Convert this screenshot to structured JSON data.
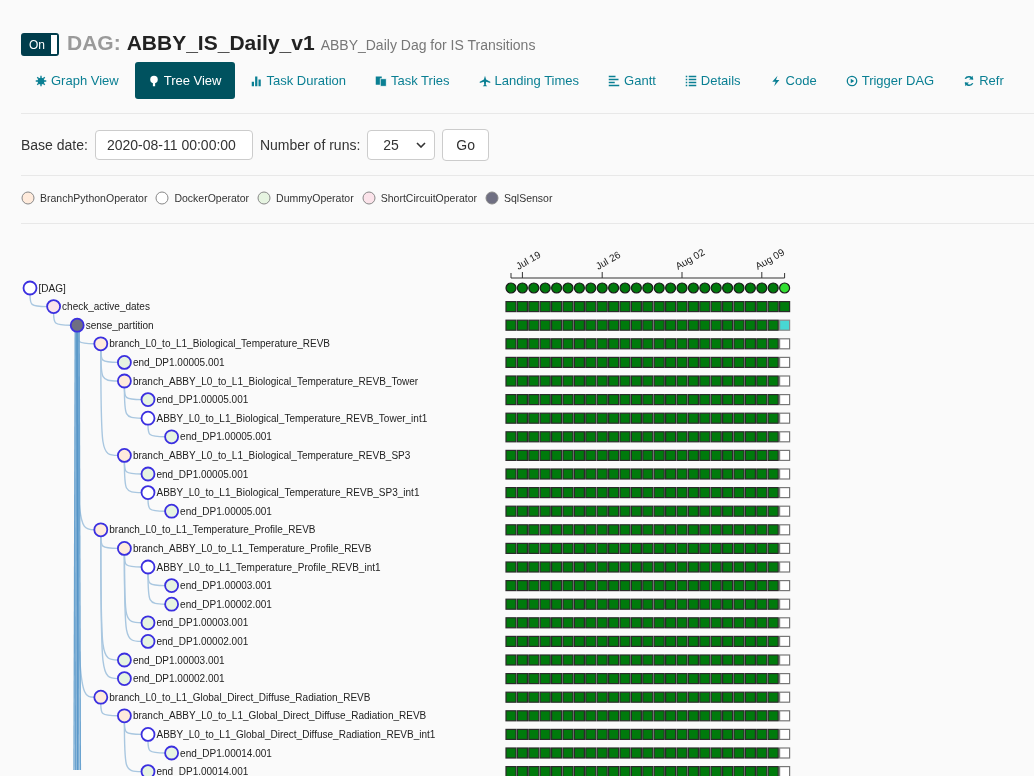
{
  "header": {
    "toggle": {
      "label": "On",
      "on": true
    },
    "prefix": "DAG:",
    "dag_id": "ABBY_IS_Daily_v1",
    "description": "ABBY_Daily Dag for IS Transitions"
  },
  "tabs": [
    {
      "label": "Graph View",
      "selected": false
    },
    {
      "label": "Tree View",
      "selected": true
    },
    {
      "label": "Task Duration",
      "selected": false
    },
    {
      "label": "Task Tries",
      "selected": false
    },
    {
      "label": "Landing Times",
      "selected": false
    },
    {
      "label": "Gantt",
      "selected": false
    },
    {
      "label": "Details",
      "selected": false
    },
    {
      "label": "Code",
      "selected": false
    },
    {
      "label": "Trigger DAG",
      "selected": false
    },
    {
      "label": "Refr",
      "selected": false
    }
  ],
  "form": {
    "base_date_label": "Base date:",
    "base_date": "2020-08-11 00:00:00",
    "runs_label": "Number of runs:",
    "runs": "25",
    "go": "Go"
  },
  "legend": [
    {
      "label": "BranchPythonOperator",
      "kind": "branch",
      "color": "#ffebdc"
    },
    {
      "label": "DockerOperator",
      "kind": "docker",
      "color": "#ffffff"
    },
    {
      "label": "DummyOperator",
      "kind": "dummy",
      "color": "#e6f4e1"
    },
    {
      "label": "ShortCircuitOperator",
      "kind": "short_circuit",
      "color": "#fbe3ea"
    },
    {
      "label": "SqlSensor",
      "kind": "sensor",
      "color": "#6f6f82"
    }
  ],
  "timeline": [
    "Jul 19",
    "Jul 26",
    "Aug 02",
    "Aug 09"
  ],
  "tree": {
    "label": "[DAG]",
    "kind": "dag",
    "last_run": {
      "kind": "running"
    },
    "children": [
      {
        "label": "check_active_dates",
        "kind": "short_circuit",
        "last_run": {
          "kind": "success"
        },
        "children": [
          {
            "label": "sense_partition",
            "kind": "sensor",
            "last_run": {
              "kind": "up_for_reschedule"
            },
            "children": [
              {
                "label": "branch_L0_to_L1_Biological_Temperature_REVB",
                "kind": "branch",
                "last_run": {
                  "kind": "none"
                },
                "children": [
                  {
                    "label": "end_DP1.00005.001",
                    "kind": "dummy",
                    "last_run": {
                      "kind": "none"
                    }
                  },
                  {
                    "label": "branch_ABBY_L0_to_L1_Biological_Temperature_REVB_Tower",
                    "kind": "branch",
                    "last_run": {
                      "kind": "none"
                    },
                    "children": [
                      {
                        "label": "end_DP1.00005.001",
                        "kind": "dummy",
                        "last_run": {
                          "kind": "none"
                        }
                      },
                      {
                        "label": "ABBY_L0_to_L1_Biological_Temperature_REVB_Tower_int1",
                        "kind": "docker",
                        "last_run": {
                          "kind": "none"
                        },
                        "children": [
                          {
                            "label": "end_DP1.00005.001",
                            "kind": "dummy",
                            "last_run": {
                              "kind": "none"
                            }
                          }
                        ]
                      }
                    ]
                  },
                  {
                    "label": "branch_ABBY_L0_to_L1_Biological_Temperature_REVB_SP3",
                    "kind": "branch",
                    "last_run": {
                      "kind": "none"
                    },
                    "children": [
                      {
                        "label": "end_DP1.00005.001",
                        "kind": "dummy",
                        "last_run": {
                          "kind": "none"
                        }
                      },
                      {
                        "label": "ABBY_L0_to_L1_Biological_Temperature_REVB_SP3_int1",
                        "kind": "docker",
                        "last_run": {
                          "kind": "none"
                        },
                        "children": [
                          {
                            "label": "end_DP1.00005.001",
                            "kind": "dummy",
                            "last_run": {
                              "kind": "none"
                            }
                          }
                        ]
                      }
                    ]
                  }
                ]
              },
              {
                "label": "branch_L0_to_L1_Temperature_Profile_REVB",
                "kind": "branch",
                "last_run": {
                  "kind": "none"
                },
                "children": [
                  {
                    "label": "branch_ABBY_L0_to_L1_Temperature_Profile_REVB",
                    "kind": "branch",
                    "last_run": {
                      "kind": "none"
                    },
                    "children": [
                      {
                        "label": "ABBY_L0_to_L1_Temperature_Profile_REVB_int1",
                        "kind": "docker",
                        "last_run": {
                          "kind": "none"
                        },
                        "children": [
                          {
                            "label": "end_DP1.00003.001",
                            "kind": "dummy",
                            "last_run": {
                              "kind": "none"
                            }
                          },
                          {
                            "label": "end_DP1.00002.001",
                            "kind": "dummy",
                            "last_run": {
                              "kind": "none"
                            }
                          }
                        ]
                      },
                      {
                        "label": "end_DP1.00003.001",
                        "kind": "dummy",
                        "last_run": {
                          "kind": "none"
                        }
                      },
                      {
                        "label": "end_DP1.00002.001",
                        "kind": "dummy",
                        "last_run": {
                          "kind": "none"
                        }
                      }
                    ]
                  },
                  {
                    "label": "end_DP1.00003.001",
                    "kind": "dummy",
                    "last_run": {
                      "kind": "none"
                    }
                  },
                  {
                    "label": "end_DP1.00002.001",
                    "kind": "dummy",
                    "last_run": {
                      "kind": "none"
                    }
                  }
                ]
              },
              {
                "label": "branch_L0_to_L1_Global_Direct_Diffuse_Radiation_REVB",
                "kind": "branch",
                "last_run": {
                  "kind": "none"
                },
                "children": [
                  {
                    "label": "branch_ABBY_L0_to_L1_Global_Direct_Diffuse_Radiation_REVB",
                    "kind": "branch",
                    "last_run": {
                      "kind": "none"
                    },
                    "children": [
                      {
                        "label": "ABBY_L0_to_L1_Global_Direct_Diffuse_Radiation_REVB_int1",
                        "kind": "docker",
                        "last_run": {
                          "kind": "none"
                        },
                        "children": [
                          {
                            "label": "end_DP1.00014.001",
                            "kind": "dummy",
                            "last_run": {
                              "kind": "none"
                            }
                          }
                        ]
                      },
                      {
                        "label": "end_DP1.00014.001",
                        "kind": "dummy",
                        "last_run": {
                          "kind": "none"
                        }
                      }
                    ]
                  }
                ]
              }
            ]
          }
        ]
      }
    ]
  }
}
